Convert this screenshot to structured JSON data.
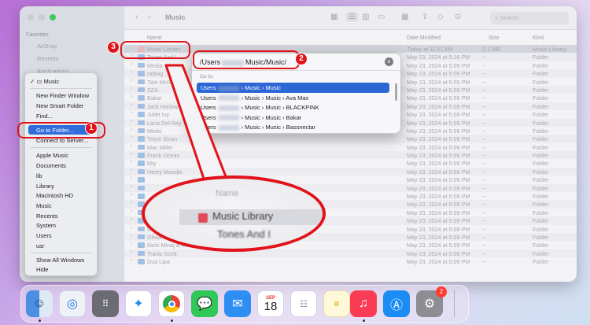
{
  "window": {
    "title": "Music",
    "search_placeholder": "Search"
  },
  "sidebar": {
    "favorites_heading": "Favorites",
    "items": [
      "AirDrop",
      "Recents",
      "Applications"
    ]
  },
  "columns": {
    "name": "Name",
    "date": "Date Modified",
    "size": "Size",
    "kind": "Kind"
  },
  "rows": [
    {
      "name": "Music Library",
      "date": "Today at 11:11 AM",
      "size": "2.1 MB",
      "kind": "Music Library",
      "file": true
    },
    {
      "name": "Tones And I",
      "date": "May 23, 2024 at 5:16 PM",
      "size": "--",
      "kind": "Folder"
    },
    {
      "name": "Media",
      "date": "May 23, 2024 at 5:09 PM",
      "size": "--",
      "kind": "Folder"
    },
    {
      "name": "ratbag",
      "date": "May 23, 2024 at 5:09 PM",
      "size": "--",
      "kind": "Folder"
    },
    {
      "name": "Tate McRae",
      "date": "May 23, 2024 at 5:09 PM",
      "size": "--",
      "kind": "Folder"
    },
    {
      "name": "SZA",
      "date": "May 23, 2024 at 5:09 PM",
      "size": "--",
      "kind": "Folder"
    },
    {
      "name": "Bakar",
      "date": "May 23, 2024 at 5:09 PM",
      "size": "--",
      "kind": "Folder"
    },
    {
      "name": "Jack Harlow",
      "date": "May 23, 2024 at 5:09 PM",
      "size": "--",
      "kind": "Folder"
    },
    {
      "name": "Juliet Ivy",
      "date": "May 23, 2024 at 5:09 PM",
      "size": "--",
      "kind": "Folder"
    },
    {
      "name": "Lana Del Rey",
      "date": "May 23, 2024 at 5:09 PM",
      "size": "--",
      "kind": "Folder"
    },
    {
      "name": "Mitski",
      "date": "May 23, 2024 at 5:09 PM",
      "size": "--",
      "kind": "Folder"
    },
    {
      "name": "Troye Sivan",
      "date": "May 23, 2024 at 5:09 PM",
      "size": "--",
      "kind": "Folder"
    },
    {
      "name": "Mac Miller",
      "date": "May 23, 2024 at 5:09 PM",
      "size": "--",
      "kind": "Folder"
    },
    {
      "name": "Frank Ocean",
      "date": "May 23, 2024 at 5:09 PM",
      "size": "--",
      "kind": "Folder"
    },
    {
      "name": "bby",
      "date": "May 23, 2024 at 5:09 PM",
      "size": "--",
      "kind": "Folder"
    },
    {
      "name": "Henry Moodie",
      "date": "May 23, 2024 at 5:09 PM",
      "size": "--",
      "kind": "Folder"
    },
    {
      "name": "",
      "date": "May 23, 2024 at 5:09 PM",
      "size": "--",
      "kind": "Folder"
    },
    {
      "name": "",
      "date": "May 23, 2024 at 5:09 PM",
      "size": "--",
      "kind": "Folder"
    },
    {
      "name": "",
      "date": "May 23, 2024 at 5:09 PM",
      "size": "--",
      "kind": "Folder"
    },
    {
      "name": "",
      "date": "May 23, 2024 at 5:09 PM",
      "size": "--",
      "kind": "Folder"
    },
    {
      "name": "",
      "date": "May 23, 2024 at 5:09 PM",
      "size": "--",
      "kind": "Folder"
    },
    {
      "name": "Billie Eilish",
      "date": "May 23, 2024 at 5:09 PM",
      "size": "--",
      "kind": "Folder"
    },
    {
      "name": "Doja Cat",
      "date": "May 23, 2024 at 5:09 PM",
      "size": "--",
      "kind": "Folder"
    },
    {
      "name": "Olivia Rodrigo",
      "date": "May 23, 2024 at 5:09 PM",
      "size": "--",
      "kind": "Folder"
    },
    {
      "name": "Nicki Minaj & Ice Spice",
      "date": "May 23, 2024 at 5:09 PM",
      "size": "--",
      "kind": "Folder"
    },
    {
      "name": "Travis Scott",
      "date": "May 23, 2024 at 5:09 PM",
      "size": "--",
      "kind": "Folder"
    },
    {
      "name": "Dua Lipa",
      "date": "May 23, 2024 at 5:09 PM",
      "size": "--",
      "kind": "Folder"
    }
  ],
  "context_menu": {
    "checked_item": "Music",
    "items": [
      "New Finder Window",
      "New Smart Folder",
      "Find...",
      "Go to Folder...",
      "Connect to Server...",
      "Apple Music",
      "Documents",
      "lib",
      "Library",
      "Macintosh HD",
      "Music",
      "Recents",
      "System",
      "Users",
      "usr",
      "Show All Windows",
      "Hide"
    ]
  },
  "goto": {
    "input_start": "/Users",
    "input_end": "Music/Music/",
    "label": "Go to:",
    "clear": "×",
    "results": [
      {
        "start": "Users",
        "end": "› Music › Music"
      },
      {
        "start": "Users",
        "end": "› Music › Music › Ava Max"
      },
      {
        "start": "Users",
        "end": "› Music › Music › BLACKPINK"
      },
      {
        "start": "Users",
        "end": "› Music › Music › Bakar"
      },
      {
        "start": "Users",
        "end": "› Music › Music › Bassnectar"
      }
    ]
  },
  "callout": {
    "header": "Name",
    "item": "Music Library",
    "next": "Tones And I"
  },
  "badges": [
    "1",
    "2",
    "3"
  ],
  "dock": {
    "calendar_month": "SEP",
    "calendar_day": "18",
    "settings_badge": "2"
  },
  "colors": {
    "accent_red": "#e1131a",
    "selection_blue": "#2d67d6"
  }
}
